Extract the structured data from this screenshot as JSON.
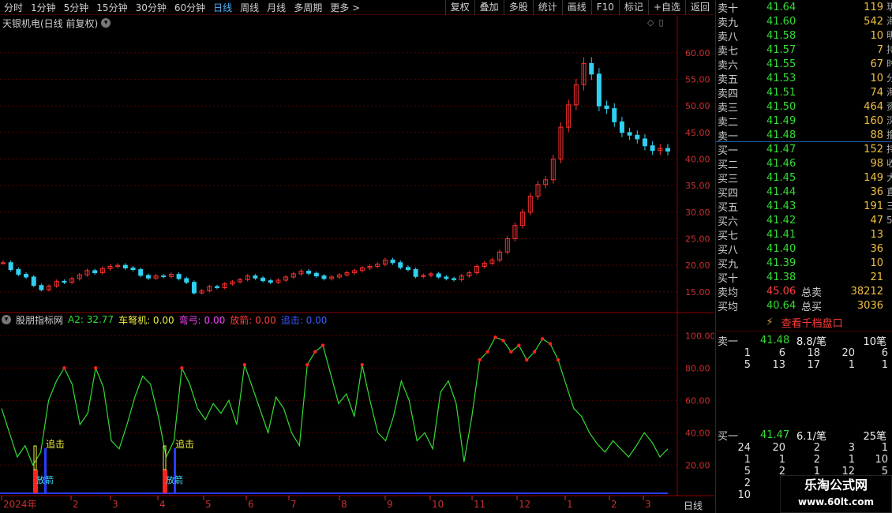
{
  "toolbar": {
    "periods": [
      "分时",
      "1分钟",
      "5分钟",
      "15分钟",
      "30分钟",
      "60分钟",
      "日线",
      "周线",
      "月线",
      "多周期",
      "更多 >"
    ],
    "active": "日线",
    "right": [
      "复权",
      "叠加",
      "多股",
      "统计",
      "画线",
      "F10",
      "标记",
      "+自选",
      "返回"
    ]
  },
  "chart_title": "天银机电(日线 前复权)",
  "price_axis": [
    "60.00",
    "55.00",
    "50.00",
    "45.00",
    "40.00",
    "35.00",
    "30.00",
    "25.00",
    "20.00",
    "15.00"
  ],
  "indicator": {
    "name": "股朋指标网",
    "a2": "A2: 32.77",
    "chejiji": "车弩机: 0.00",
    "wangong": "弯弓: 0.00",
    "fangjian": "放箭: 0.00",
    "zhuiji": "追击: 0.00",
    "axis": [
      "100.00",
      "80.00",
      "60.00",
      "40.00",
      "20.00"
    ],
    "signal1": "追击",
    "signal2": "追击",
    "arrow_text": "放箭"
  },
  "date_axis": [
    "2024年",
    "2",
    "3",
    "4",
    "5",
    "6",
    "7",
    "8",
    "9",
    "10",
    "11",
    "12",
    "1",
    "2",
    "3"
  ],
  "period_label": "日线",
  "orderbook": {
    "asks": [
      {
        "label": "卖十",
        "price": "41.64",
        "vol": "119"
      },
      {
        "label": "卖九",
        "price": "41.60",
        "vol": "542"
      },
      {
        "label": "卖八",
        "price": "41.58",
        "vol": "10"
      },
      {
        "label": "卖七",
        "price": "41.57",
        "vol": "7"
      },
      {
        "label": "卖六",
        "price": "41.55",
        "vol": "67"
      },
      {
        "label": "卖五",
        "price": "41.53",
        "vol": "10"
      },
      {
        "label": "卖四",
        "price": "41.51",
        "vol": "74"
      },
      {
        "label": "卖三",
        "price": "41.50",
        "vol": "464"
      },
      {
        "label": "卖二",
        "price": "41.49",
        "vol": "160"
      },
      {
        "label": "卖一",
        "price": "41.48",
        "vol": "88"
      }
    ],
    "bids": [
      {
        "label": "买一",
        "price": "41.47",
        "vol": "152"
      },
      {
        "label": "买二",
        "price": "41.46",
        "vol": "98"
      },
      {
        "label": "买三",
        "price": "41.45",
        "vol": "149"
      },
      {
        "label": "买四",
        "price": "41.44",
        "vol": "36"
      },
      {
        "label": "买五",
        "price": "41.43",
        "vol": "191"
      },
      {
        "label": "买六",
        "price": "41.42",
        "vol": "47"
      },
      {
        "label": "买七",
        "price": "41.41",
        "vol": "13"
      },
      {
        "label": "买八",
        "price": "41.40",
        "vol": "36"
      },
      {
        "label": "买九",
        "price": "41.39",
        "vol": "10"
      },
      {
        "label": "买十",
        "price": "41.38",
        "vol": "21"
      }
    ],
    "avg_sell_label": "卖均",
    "avg_sell": "45.06",
    "total_sell_label": "总卖",
    "total_sell": "38212",
    "avg_buy_label": "买均",
    "avg_buy": "40.64",
    "total_buy_label": "总买",
    "total_buy": "3036"
  },
  "qianbang": "查看千档盘口",
  "depth_sell": {
    "label": "卖一",
    "price": "41.48",
    "per": "8.8/笔",
    "count": "10笔",
    "rows": [
      [
        "1",
        "6",
        "18",
        "20",
        "6"
      ],
      [
        "5",
        "13",
        "17",
        "1",
        "1"
      ]
    ]
  },
  "depth_buy": {
    "label": "买一",
    "price": "41.47",
    "per": "6.1/笔",
    "count": "25笔",
    "rows": [
      [
        "24",
        "20",
        "2",
        "3",
        "1"
      ],
      [
        "1",
        "1",
        "2",
        "1",
        "10"
      ],
      [
        "5",
        "2",
        "1",
        "12",
        "5"
      ],
      [
        "2",
        "",
        "",
        "",
        ""
      ],
      [
        "10",
        "",
        "",
        "",
        ""
      ]
    ]
  },
  "side_strip": [
    "玥",
    "海",
    "明",
    "持",
    "时",
    "分",
    "海",
    "资",
    "深",
    "撸",
    "持",
    "收",
    "大",
    "直",
    "三",
    "5"
  ],
  "watermark": {
    "title": "乐淘公式网",
    "url": "www.60lt.com"
  },
  "chart_data": {
    "type": "line",
    "xlabel": "",
    "ylabel": "",
    "ylim_price": [
      12,
      64
    ],
    "ylim_indicator": [
      5,
      105
    ],
    "close_series": [
      20.5,
      19.2,
      18.3,
      17.8,
      16.2,
      15.4,
      16.1,
      17.0,
      16.8,
      17.5,
      18.2,
      19.0,
      18.6,
      19.4,
      19.8,
      20.0,
      19.5,
      19.2,
      18.1,
      17.6,
      18.0,
      17.9,
      18.3,
      17.5,
      16.8,
      14.8,
      15.2,
      16.0,
      15.8,
      16.5,
      16.9,
      17.3,
      18.0,
      17.6,
      17.1,
      16.8,
      17.2,
      17.8,
      18.4,
      18.9,
      18.5,
      18.0,
      17.5,
      17.8,
      18.2,
      18.6,
      19.0,
      19.5,
      19.8,
      20.2,
      21.0,
      20.5,
      19.6,
      19.2,
      17.9,
      18.1,
      18.4,
      17.8,
      17.5,
      17.3,
      18.0,
      18.6,
      19.8,
      20.4,
      21.0,
      22.5,
      25.0,
      27.5,
      30.0,
      33.0,
      35.2,
      36.1,
      40.0,
      46.0,
      50.2,
      54.0,
      58.0,
      56.0,
      50.0,
      49.5,
      47.0,
      45.0,
      44.5,
      43.8,
      42.5,
      41.6,
      42.0,
      41.5
    ],
    "indicator_series": [
      55,
      40,
      25,
      32,
      20,
      28,
      60,
      72,
      80,
      70,
      45,
      52,
      80,
      68,
      35,
      30,
      45,
      62,
      75,
      70,
      50,
      25,
      35,
      80,
      70,
      55,
      48,
      58,
      52,
      60,
      45,
      82,
      68,
      54,
      40,
      62,
      55,
      40,
      32,
      82,
      90,
      94,
      76,
      58,
      64,
      50,
      82,
      60,
      40,
      35,
      50,
      72,
      60,
      35,
      40,
      30,
      65,
      72,
      58,
      22,
      50,
      85,
      90,
      99,
      97,
      90,
      94,
      85,
      90,
      98,
      95,
      85,
      70,
      55,
      50,
      40,
      33,
      28,
      35,
      30,
      25,
      32,
      40,
      34,
      25,
      30
    ],
    "signals": [
      {
        "label": "追击"
      },
      {
        "label": "追击"
      }
    ]
  }
}
